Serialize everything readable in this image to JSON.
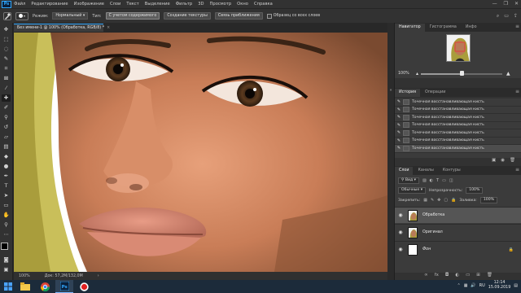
{
  "app": {
    "logo": "Ps",
    "menu": [
      "Файл",
      "Редактирование",
      "Изображение",
      "Слои",
      "Текст",
      "Выделение",
      "Фильтр",
      "3D",
      "Просмотр",
      "Окно",
      "Справка"
    ],
    "window_controls": [
      "—",
      "❐",
      "✕"
    ]
  },
  "options_bar": {
    "mode_label": "Режим:",
    "mode_value": "Нормальный",
    "type_label": "Тип:",
    "type_buttons": [
      "С учетом содержимого",
      "Создание текстуры",
      "Связь приближения"
    ],
    "active_type_index": 0,
    "sample_all_layers": "Образец со всех слоев"
  },
  "document": {
    "tab_title": "Без имени-1 @ 100% (Обработка, RGB/8) *",
    "zoom": "100%",
    "doc_info": "Док: 57,2M/132,0M"
  },
  "navigator": {
    "tabs": [
      "Навигатор",
      "Гистограмма",
      "Инфо"
    ],
    "zoom": "100%",
    "zoom_level": 0.5
  },
  "history": {
    "tabs": [
      "История",
      "Операции"
    ],
    "items": [
      "Точечная восстанавливающая кисть",
      "Точечная восстанавливающая кисть",
      "Точечная восстанавливающая кисть",
      "Точечная восстанавливающая кисть",
      "Точечная восстанавливающая кисть",
      "Точечная восстанавливающая кисть",
      "Точечная восстанавливающая кисть"
    ],
    "active_index": 6
  },
  "layers": {
    "tabs": [
      "Слои",
      "Каналы",
      "Контуры"
    ],
    "filter_kind": "Вид",
    "blend_mode": "Обычные",
    "opacity_label": "Непрозрачность:",
    "opacity_value": "100%",
    "lock_label": "Закрепить:",
    "fill_label": "Заливка:",
    "fill_value": "100%",
    "items": [
      {
        "name": "Обработка",
        "active": true
      },
      {
        "name": "Оригинал",
        "active": false
      },
      {
        "name": "Фон",
        "active": false
      }
    ]
  },
  "taskbar": {
    "lang": "RU",
    "time": "12:14",
    "date": "15.09.2019"
  },
  "colors": {
    "accent": "#31a8ff",
    "panel_bg": "#323232",
    "canvas_bg": "#262626",
    "taskbar_bg": "#1c2b3a"
  }
}
